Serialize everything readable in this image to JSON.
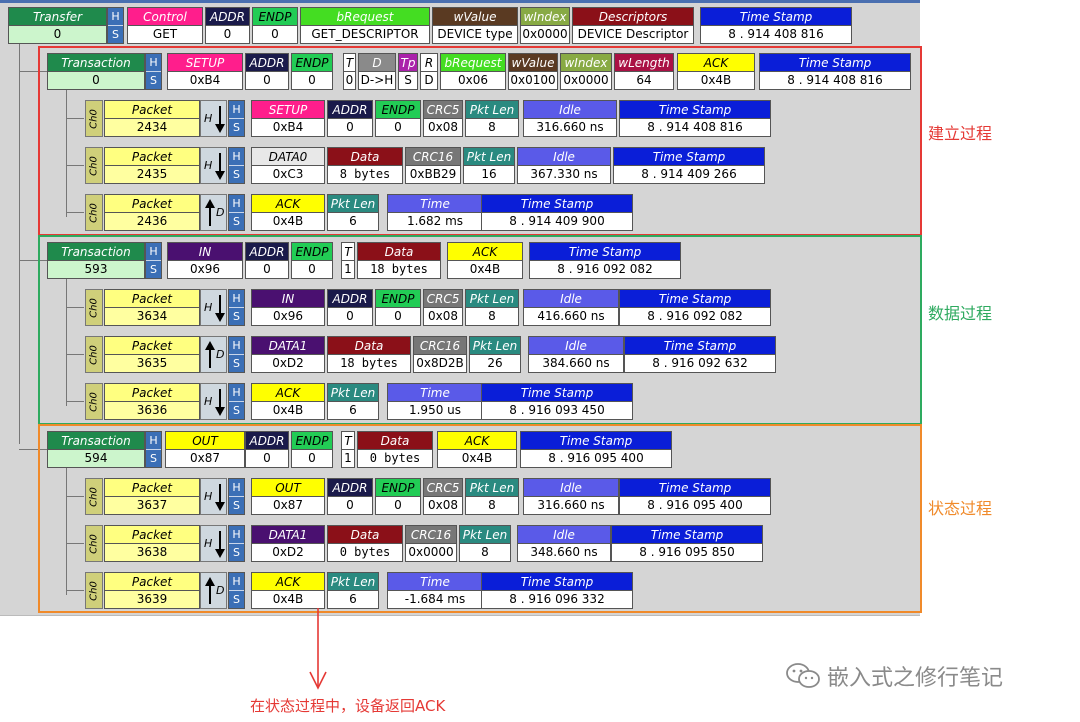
{
  "colors": {
    "red": "#e53935",
    "green": "#2eaa5f",
    "orange": "#f08a2a"
  },
  "transfer": {
    "cells": [
      {
        "h": "Transfer",
        "v": "0"
      },
      {
        "h": "Control",
        "v": "GET"
      },
      {
        "h": "ADDR",
        "v": "0"
      },
      {
        "h": "ENDP",
        "v": "0"
      },
      {
        "h": "bRequest",
        "v": "GET_DESCRIPTOR"
      },
      {
        "h": "wValue",
        "v": "DEVICE type"
      },
      {
        "h": "wIndex",
        "v": "0x0000"
      },
      {
        "h": "Descriptors",
        "v": "DEVICE Descriptor"
      },
      {
        "h": "Time Stamp",
        "v": "8 . 914 408 816"
      }
    ]
  },
  "hs": {
    "h": "H",
    "s": "S"
  },
  "transactions": [
    {
      "label": "建立过程",
      "row": [
        {
          "h": "Transaction",
          "v": "0"
        },
        {
          "h": "SETUP",
          "v": "0xB4"
        },
        {
          "h": "ADDR",
          "v": "0"
        },
        {
          "h": "ENDP",
          "v": "0"
        },
        {
          "h": "T",
          "v": "0"
        },
        {
          "h": "D",
          "v": "D->H"
        },
        {
          "h": "Tp",
          "v": "S"
        },
        {
          "h": "R",
          "v": "D"
        },
        {
          "h": "bRequest",
          "v": "0x06"
        },
        {
          "h": "wValue",
          "v": "0x0100"
        },
        {
          "h": "wIndex",
          "v": "0x0000"
        },
        {
          "h": "wLength",
          "v": "64"
        },
        {
          "h": "ACK",
          "v": "0x4B"
        },
        {
          "h": "Time Stamp",
          "v": "8 . 914 408 816"
        }
      ],
      "packets": [
        {
          "ch": "Ch0",
          "dir": "H",
          "cells": [
            {
              "h": "Packet",
              "v": "2434"
            },
            {
              "h": "SETUP",
              "v": "0xB4"
            },
            {
              "h": "ADDR",
              "v": "0"
            },
            {
              "h": "ENDP",
              "v": "0"
            },
            {
              "h": "CRC5",
              "v": "0x08"
            },
            {
              "h": "Pkt Len",
              "v": "8"
            },
            {
              "h": "Idle",
              "v": "316.660 ns"
            },
            {
              "h": "Time Stamp",
              "v": "8 . 914 408 816"
            }
          ]
        },
        {
          "ch": "Ch0",
          "dir": "H",
          "cells": [
            {
              "h": "Packet",
              "v": "2435"
            },
            {
              "h": "DATA0",
              "v": "0xC3"
            },
            {
              "h": "Data",
              "v": "8 bytes"
            },
            {
              "h": "CRC16",
              "v": "0xBB29"
            },
            {
              "h": "Pkt Len",
              "v": "16"
            },
            {
              "h": "Idle",
              "v": "367.330 ns"
            },
            {
              "h": "Time Stamp",
              "v": "8 . 914 409 266"
            }
          ]
        },
        {
          "ch": "Ch0",
          "dir": "D",
          "cells": [
            {
              "h": "Packet",
              "v": "2436"
            },
            {
              "h": "ACK",
              "v": "0x4B"
            },
            {
              "h": "Pkt Len",
              "v": "6"
            },
            {
              "h": "Time",
              "v": "1.682 ms"
            },
            {
              "h": "Time Stamp",
              "v": "8 . 914 409 900"
            }
          ]
        }
      ]
    },
    {
      "label": "数据过程",
      "row": [
        {
          "h": "Transaction",
          "v": "593"
        },
        {
          "h": "IN",
          "v": "0x96"
        },
        {
          "h": "ADDR",
          "v": "0"
        },
        {
          "h": "ENDP",
          "v": "0"
        },
        {
          "h": "T",
          "v": "1"
        },
        {
          "h": "Data",
          "v": "18 bytes"
        },
        {
          "h": "ACK",
          "v": "0x4B"
        },
        {
          "h": "Time Stamp",
          "v": "8 . 916 092 082"
        }
      ],
      "packets": [
        {
          "ch": "Ch0",
          "dir": "H",
          "cells": [
            {
              "h": "Packet",
              "v": "3634"
            },
            {
              "h": "IN",
              "v": "0x96"
            },
            {
              "h": "ADDR",
              "v": "0"
            },
            {
              "h": "ENDP",
              "v": "0"
            },
            {
              "h": "CRC5",
              "v": "0x08"
            },
            {
              "h": "Pkt Len",
              "v": "8"
            },
            {
              "h": "Idle",
              "v": "416.660 ns"
            },
            {
              "h": "Time Stamp",
              "v": "8 . 916 092 082"
            }
          ]
        },
        {
          "ch": "Ch0",
          "dir": "D",
          "cells": [
            {
              "h": "Packet",
              "v": "3635"
            },
            {
              "h": "DATA1",
              "v": "0xD2"
            },
            {
              "h": "Data",
              "v": "18 bytes"
            },
            {
              "h": "CRC16",
              "v": "0x8D2B"
            },
            {
              "h": "Pkt Len",
              "v": "26"
            },
            {
              "h": "Idle",
              "v": "384.660 ns"
            },
            {
              "h": "Time Stamp",
              "v": "8 . 916 092 632"
            }
          ]
        },
        {
          "ch": "Ch0",
          "dir": "H",
          "cells": [
            {
              "h": "Packet",
              "v": "3636"
            },
            {
              "h": "ACK",
              "v": "0x4B"
            },
            {
              "h": "Pkt Len",
              "v": "6"
            },
            {
              "h": "Time",
              "v": "1.950 us"
            },
            {
              "h": "Time Stamp",
              "v": "8 . 916 093 450"
            }
          ]
        }
      ]
    },
    {
      "label": "状态过程",
      "row": [
        {
          "h": "Transaction",
          "v": "594"
        },
        {
          "h": "OUT",
          "v": "0x87"
        },
        {
          "h": "ADDR",
          "v": "0"
        },
        {
          "h": "ENDP",
          "v": "0"
        },
        {
          "h": "T",
          "v": "1"
        },
        {
          "h": "Data",
          "v": "0 bytes"
        },
        {
          "h": "ACK",
          "v": "0x4B"
        },
        {
          "h": "Time Stamp",
          "v": "8 . 916 095 400"
        }
      ],
      "packets": [
        {
          "ch": "Ch0",
          "dir": "H",
          "cells": [
            {
              "h": "Packet",
              "v": "3637"
            },
            {
              "h": "OUT",
              "v": "0x87"
            },
            {
              "h": "ADDR",
              "v": "0"
            },
            {
              "h": "ENDP",
              "v": "0"
            },
            {
              "h": "CRC5",
              "v": "0x08"
            },
            {
              "h": "Pkt Len",
              "v": "8"
            },
            {
              "h": "Idle",
              "v": "316.660 ns"
            },
            {
              "h": "Time Stamp",
              "v": "8 . 916 095 400"
            }
          ]
        },
        {
          "ch": "Ch0",
          "dir": "H",
          "cells": [
            {
              "h": "Packet",
              "v": "3638"
            },
            {
              "h": "DATA1",
              "v": "0xD2"
            },
            {
              "h": "Data",
              "v": "0 bytes"
            },
            {
              "h": "CRC16",
              "v": "0x0000"
            },
            {
              "h": "Pkt Len",
              "v": "8"
            },
            {
              "h": "Idle",
              "v": "348.660 ns"
            },
            {
              "h": "Time Stamp",
              "v": "8 . 916 095 850"
            }
          ]
        },
        {
          "ch": "Ch0",
          "dir": "D",
          "cells": [
            {
              "h": "Packet",
              "v": "3639"
            },
            {
              "h": "ACK",
              "v": "0x4B"
            },
            {
              "h": "Pkt Len",
              "v": "6"
            },
            {
              "h": "Time",
              "v": "-1.684 ms"
            },
            {
              "h": "Time Stamp",
              "v": "8 . 916 096 332"
            }
          ]
        }
      ]
    }
  ],
  "bottom_note": "在状态过程中，设备返回ACK",
  "watermark": "嵌入式之修行笔记"
}
